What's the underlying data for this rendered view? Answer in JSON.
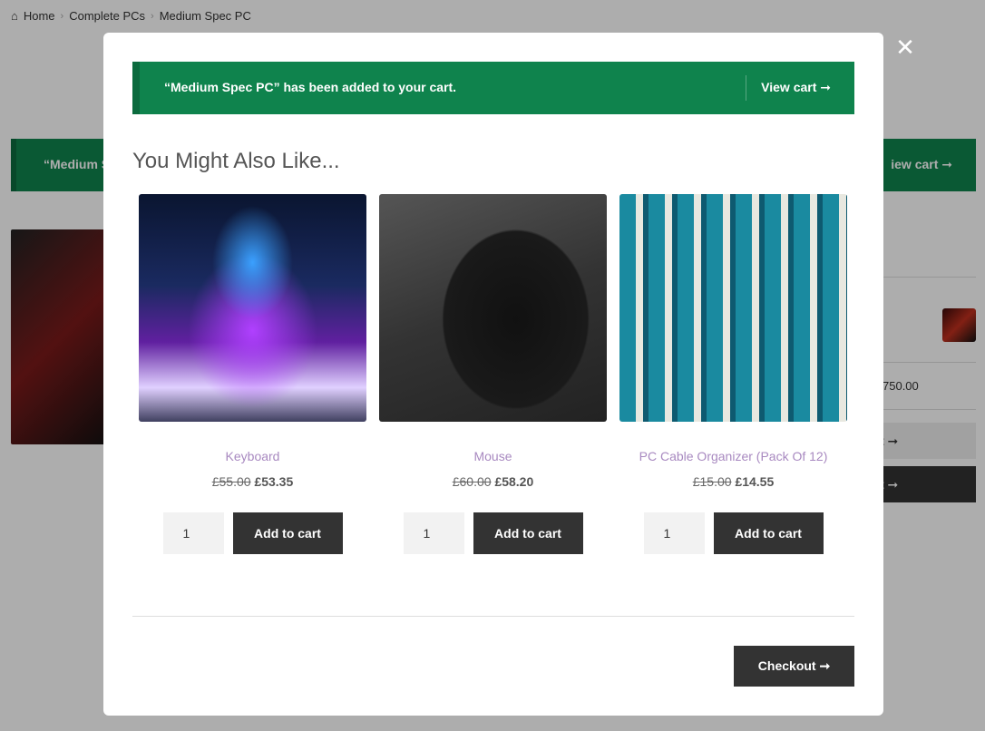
{
  "breadcrumb": [
    "Home",
    "Complete PCs",
    "Medium Spec PC"
  ],
  "background": {
    "notice_left": "“Medium S",
    "notice_right": "iew cart ➞",
    "price": "750.00",
    "btn1": "t ➞",
    "btn2": "t ➞"
  },
  "modal": {
    "notice": {
      "message": "“Medium Spec PC” has been added to your cart.",
      "view_cart": "View cart ➞"
    },
    "heading": "You Might Also Like...",
    "products": [
      {
        "name": "Keyboard",
        "old_price": "£55.00",
        "price": "£53.35",
        "qty": "1",
        "button": "Add to cart"
      },
      {
        "name": "Mouse",
        "old_price": "£60.00",
        "price": "£58.20",
        "qty": "1",
        "button": "Add to cart"
      },
      {
        "name": "PC Cable Organizer (Pack Of 12)",
        "old_price": "£15.00",
        "price": "£14.55",
        "qty": "1",
        "button": "Add to cart"
      }
    ],
    "checkout": "Checkout ➞",
    "close": "✕"
  },
  "colors": {
    "notice": "#0f834d",
    "button": "#333333",
    "link": "#a889c0"
  }
}
